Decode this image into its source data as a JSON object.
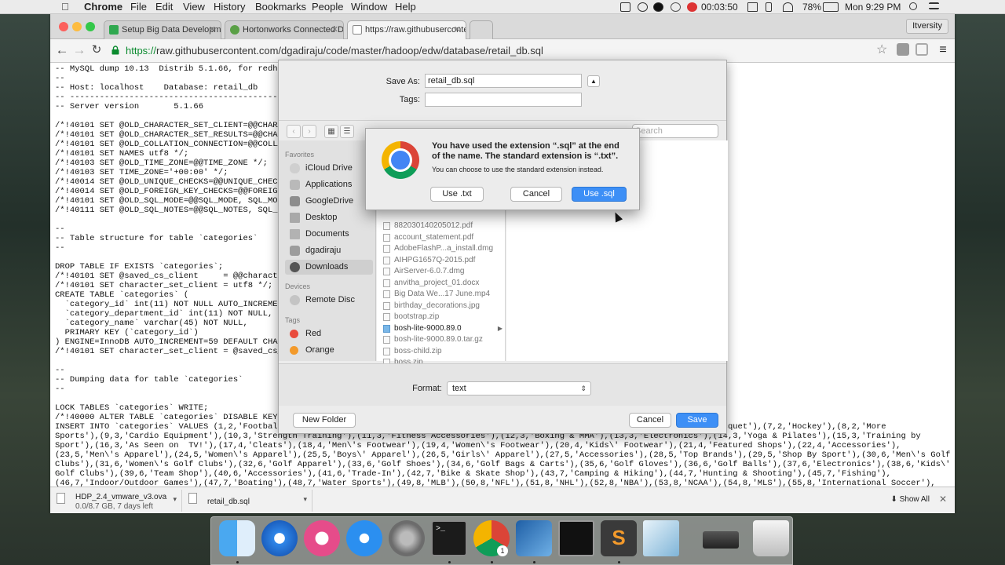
{
  "menubar": {
    "app": "Chrome",
    "items": [
      "File",
      "Edit",
      "View",
      "History",
      "Bookmarks",
      "People",
      "Window",
      "Help"
    ],
    "timer": "00:03:50",
    "battery": "78%",
    "clock": "Mon 9:29 PM"
  },
  "browser": {
    "tabs": [
      {
        "label": "Setup Big Data Developme"
      },
      {
        "label": "Hortonworks Connected Da"
      },
      {
        "label": "https://raw.githubuserconte"
      }
    ],
    "user": "Itversity",
    "url_scheme": "https://",
    "url_rest": "raw.githubusercontent.com/dgadiraju/code/master/hadoop/edw/database/retail_db.sql"
  },
  "page_lines": [
    "-- MySQL dump 10.13  Distrib 5.1.66, for redha",
    "--",
    "-- Host: localhost    Database: retail_db",
    "-- ------------------------------------------------------",
    "-- Server version       5.1.66",
    "",
    "/*!40101 SET @OLD_CHARACTER_SET_CLIENT=@@CHARA",
    "/*!40101 SET @OLD_CHARACTER_SET_RESULTS=@@CHAR",
    "/*!40101 SET @OLD_COLLATION_CONNECTION=@@COLLA",
    "/*!40101 SET NAMES utf8 */;",
    "/*!40103 SET @OLD_TIME_ZONE=@@TIME_ZONE */;",
    "/*!40103 SET TIME_ZONE='+00:00' */;",
    "/*!40014 SET @OLD_UNIQUE_CHECKS=@@UNIQUE_CHECK",
    "/*!40014 SET @OLD_FOREIGN_KEY_CHECKS=@@FOREIGN",
    "/*!40101 SET @OLD_SQL_MODE=@@SQL_MODE, SQL_MOD",
    "/*!40111 SET @OLD_SQL_NOTES=@@SQL_NOTES, SQL_N",
    "",
    "--",
    "-- Table structure for table `categories`",
    "--",
    "",
    "DROP TABLE IF EXISTS `categories`;",
    "/*!40101 SET @saved_cs_client     = @@characte",
    "/*!40101 SET character_set_client = utf8 */;",
    "CREATE TABLE `categories` (",
    "  `category_id` int(11) NOT NULL AUTO_INCREMEN",
    "  `category_department_id` int(11) NOT NULL,",
    "  `category_name` varchar(45) NOT NULL,",
    "  PRIMARY KEY (`category_id`)",
    ") ENGINE=InnoDB AUTO_INCREMENT=59 DEFAULT CHAR",
    "/*!40101 SET character_set_client = @saved_cs_",
    "",
    "--",
    "-- Dumping data for table `categories`",
    "--",
    "",
    "LOCK TABLES `categories` WRITE;",
    "/*!40000 ALTER TABLE `categories` DISABLE KEYS",
    "INSERT INTO `categories` VALUES (1,2,'Football                                                                                 nis & Racquet'),(7,2,'Hockey'),(8,2,'More",
    "Sports'),(9,3,'Cardio Equipment'),(10,3,'Strength Training'),(11,3,'Fitness Accessories'),(12,3,'Boxing & MMA'),(13,3,'Electronics'),(14,3,'Yoga & Pilates'),(15,3,'Training by",
    "Sport'),(16,3,'As Seen on  TV!'),(17,4,'Cleats'),(18,4,'Men\\'s Footwear'),(19,4,'Women\\'s Footwear'),(20,4,'Kids\\' Footwear'),(21,4,'Featured Shops'),(22,4,'Accessories'),",
    "(23,5,'Men\\'s Apparel'),(24,5,'Women\\'s Apparel'),(25,5,'Boys\\' Apparel'),(26,5,'Girls\\' Apparel'),(27,5,'Accessories'),(28,5,'Top Brands'),(29,5,'Shop By Sport'),(30,6,'Men\\'s Golf",
    "Clubs'),(31,6,'Women\\'s Golf Clubs'),(32,6,'Golf Apparel'),(33,6,'Golf Shoes'),(34,6,'Golf Bags & Carts'),(35,6,'Golf Gloves'),(36,6,'Golf Balls'),(37,6,'Electronics'),(38,6,'Kids\\'",
    "Golf Clubs'),(39,6,'Team Shop'),(40,6,'Accessories'),(41,6,'Trade-In'),(42,7,'Bike & Skate Shop'),(43,7,'Camping & Hiking'),(44,7,'Hunting & Shooting'),(45,7,'Fishing'),",
    "(46,7,'Indoor/Outdoor Games'),(47,7,'Boating'),(48,7,'Water Sports'),(49,8,'MLB'),(50,8,'NFL'),(51,8,'NHL'),(52,8,'NBA'),(53,8,'NCAA'),(54,8,'MLS'),(55,8,'International Soccer'),"
  ],
  "downloads": [
    {
      "name": "HDP_2.4_vmware_v3.ova",
      "status": "0.0/8.7 GB, 7 days left"
    },
    {
      "name": "retail_db.sql",
      "status": ""
    }
  ],
  "show_all": "Show All",
  "save_dialog": {
    "save_as_label": "Save As:",
    "save_as_value": "retail_db.sql",
    "tags_label": "Tags:",
    "search_placeholder": "Search",
    "favorites_header": "Favorites",
    "favorites": [
      "iCloud Drive",
      "Applications",
      "GoogleDrive",
      "Desktop",
      "Documents",
      "dgadiraju",
      "Downloads"
    ],
    "devices_header": "Devices",
    "devices": [
      "Remote Disc"
    ],
    "tags_header": "Tags",
    "tags": [
      {
        "name": "Red",
        "color": "#e94b3c"
      },
      {
        "name": "Orange",
        "color": "#f39a2b"
      }
    ],
    "files": [
      "882030140205012.pdf",
      "account_statement.pdf",
      "AdobeFlashP...a_install.dmg",
      "AIHPG1657Q-2015.pdf",
      "AirServer-6.0.7.dmg",
      "anvitha_project_01.docx",
      "Big Data We...17 June.mp4",
      "birthday_decorations.jpg",
      "bootstrap.zip",
      "bosh-lite-9000.89.0",
      "bosh-lite-9000.89.0.tar.gz",
      "boss-child.zip",
      "boss.zip"
    ],
    "format_label": "Format:",
    "format_value": "text",
    "new_folder": "New Folder",
    "cancel": "Cancel",
    "save": "Save"
  },
  "alert": {
    "title": "You have used the extension “.sql” at the end of the name. The standard extension is “.txt”.",
    "message": "You can choose to use the standard extension instead.",
    "use_txt": "Use .txt",
    "cancel": "Cancel",
    "use_sql": "Use .sql"
  },
  "dock_apps": [
    "Finder",
    "Safari",
    "iTunes",
    "App Store",
    "System Preferences",
    "Terminal",
    "Google Chrome",
    "VirtualBox",
    "Screen",
    "Sublime Text",
    "Preview",
    "Stacks",
    "Trash"
  ],
  "dock_badge": "1",
  "colors": {
    "accent": "#3d8ff6",
    "url_green": "#0a8a2e"
  }
}
